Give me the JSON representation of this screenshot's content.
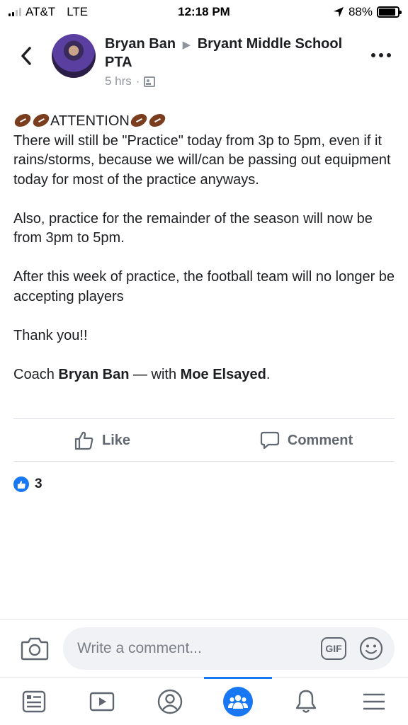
{
  "status_bar": {
    "carrier": "AT&T",
    "network": "LTE",
    "time": "12:18 PM",
    "battery": "88%",
    "battery_level": 0.88,
    "icons": [
      "signal-icon",
      "location-arrow-icon",
      "battery-icon"
    ]
  },
  "post": {
    "author": "Bryan Ban",
    "separator": "▶",
    "target": "Bryant Middle School PTA",
    "time": "5 hrs",
    "dot": "·",
    "attention": "ATTENTION",
    "para1": "There will still be \"Practice\" today from 3p to 5pm, even if it rains/storms, because we will/can be passing out equipment today for most of the practice anyways.",
    "para2": "Also, practice for the remainder of the season will now be from 3pm to 5pm.",
    "para3": "After this week of practice, the football team will no longer be accepting players",
    "para4": "Thank you!!",
    "signoff_prefix": "Coach",
    "signoff_name": "Bryan Ban",
    "signoff_with": "— with",
    "signoff_tagged": "Moe Elsayed",
    "signoff_end": "."
  },
  "actions": {
    "like": "Like",
    "comment": "Comment"
  },
  "reactions": {
    "count": "3"
  },
  "composer": {
    "placeholder": "Write a comment...",
    "gif": "GIF"
  },
  "tabs": [
    {
      "name": "News Feed",
      "icon": "news-feed-icon"
    },
    {
      "name": "Watch",
      "icon": "watch-icon"
    },
    {
      "name": "Profile",
      "icon": "profile-icon"
    },
    {
      "name": "Groups",
      "icon": "groups-icon",
      "active": true
    },
    {
      "name": "Notifications",
      "icon": "bell-icon"
    },
    {
      "name": "Menu",
      "icon": "menu-icon"
    }
  ],
  "colors": {
    "accent": "#1877f2",
    "text": "#1c1e21",
    "muted": "#606770"
  }
}
